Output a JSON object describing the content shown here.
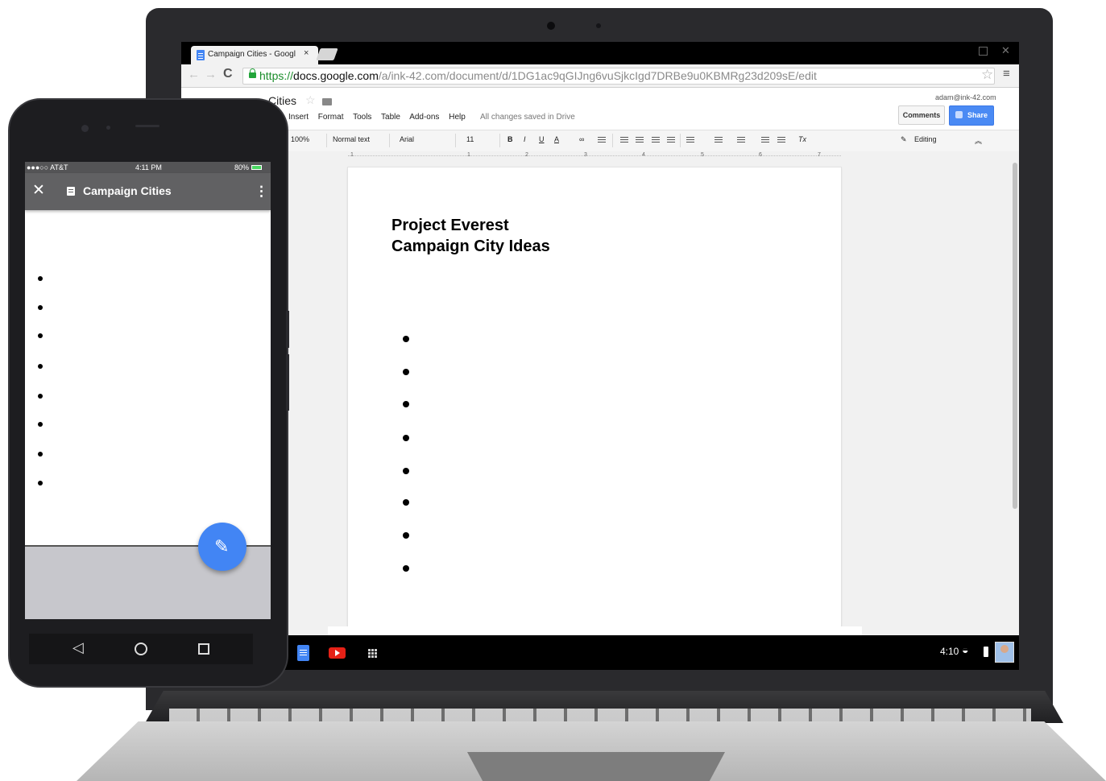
{
  "browser": {
    "tab_title": "Campaign Cities - Googl",
    "tab_close": "×",
    "url_scheme": "https://",
    "url_domain": "docs.google.com",
    "url_path": "/a/ink-42.com/document/d/1DG1ac9qGIJng6vuSjkcIgd7DRBe9u0KBMRg23d209sE/edit"
  },
  "docs": {
    "title": "Cities",
    "menus": [
      "Insert",
      "Format",
      "Tools",
      "Table",
      "Add-ons",
      "Help"
    ],
    "saved_status": "All changes saved in Drive",
    "account": "adam@ink-42.com",
    "comments_label": "Comments",
    "share_label": "Share",
    "toolbar": {
      "zoom": "100%",
      "style": "Normal text",
      "font": "Arial",
      "size": "11",
      "bold": "B",
      "italic": "I",
      "underline": "U",
      "text_color": "A",
      "clear_format": "Tx",
      "mode": "Editing"
    },
    "ruler_marks": [
      "1",
      "1",
      "2",
      "3",
      "4",
      "5",
      "6",
      "7"
    ],
    "document": {
      "title_line1": "Project Everest",
      "title_line2": "Campaign City Ideas",
      "bullet_count": 8
    }
  },
  "shelf": {
    "time": "4:10"
  },
  "phone": {
    "carrier": "●●●○○ AT&T",
    "time": "4:11 PM",
    "battery": "80%",
    "doc_title": "Campaign Cities",
    "bullet_count": 8
  },
  "colors": {
    "accent": "#4285f4",
    "share_button": "#4a8af4",
    "phone_appbar": "#616163",
    "youtube": "#e62117"
  },
  "icons": [
    "doc-icon",
    "close-icon",
    "back-icon",
    "forward-icon",
    "reload-icon",
    "lock-icon",
    "star-icon",
    "menu-icon",
    "folder-icon",
    "share-icon",
    "pencil-icon",
    "youtube-icon",
    "apps-icon",
    "wifi-icon",
    "battery-icon",
    "more-vert-icon",
    "nav-back-icon",
    "nav-home-icon",
    "nav-recents-icon"
  ]
}
